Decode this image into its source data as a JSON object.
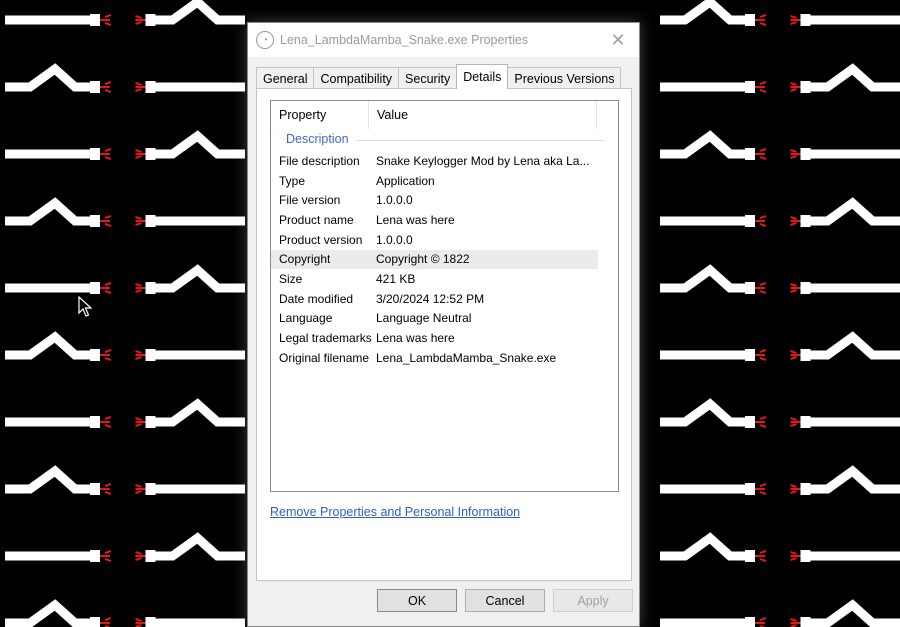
{
  "window": {
    "title": "Lena_LambdaMamba_Snake.exe Properties",
    "close_glyph": "✕"
  },
  "tabs": [
    {
      "label": "General",
      "active": false
    },
    {
      "label": "Compatibility",
      "active": false
    },
    {
      "label": "Security",
      "active": false
    },
    {
      "label": "Details",
      "active": true
    },
    {
      "label": "Previous Versions",
      "active": false
    }
  ],
  "details": {
    "col_property": "Property",
    "col_value": "Value",
    "group": "Description",
    "rows": [
      {
        "property": "File description",
        "value": "Snake Keylogger Mod by Lena aka La..."
      },
      {
        "property": "Type",
        "value": "Application"
      },
      {
        "property": "File version",
        "value": "1.0.0.0"
      },
      {
        "property": "Product name",
        "value": "Lena was here"
      },
      {
        "property": "Product version",
        "value": "1.0.0.0"
      },
      {
        "property": "Copyright",
        "value": "Copyright ©  1822"
      },
      {
        "property": "Size",
        "value": "421 KB"
      },
      {
        "property": "Date modified",
        "value": "3/20/2024 12:52 PM"
      },
      {
        "property": "Language",
        "value": "Language Neutral"
      },
      {
        "property": "Legal trademarks",
        "value": "Lena was here"
      },
      {
        "property": "Original filename",
        "value": "Lena_LambdaMamba_Snake.exe"
      }
    ],
    "selected_row": 5
  },
  "remove_link": "Remove Properties and Personal Information",
  "buttons": {
    "ok": "OK",
    "cancel": "Cancel",
    "apply": "Apply"
  },
  "colors": {
    "background": "#000000",
    "snake_body": "#ffffff",
    "snake_tongue": "#e01818",
    "link": "#2f5fc4",
    "group_header": "#3a68c8"
  }
}
